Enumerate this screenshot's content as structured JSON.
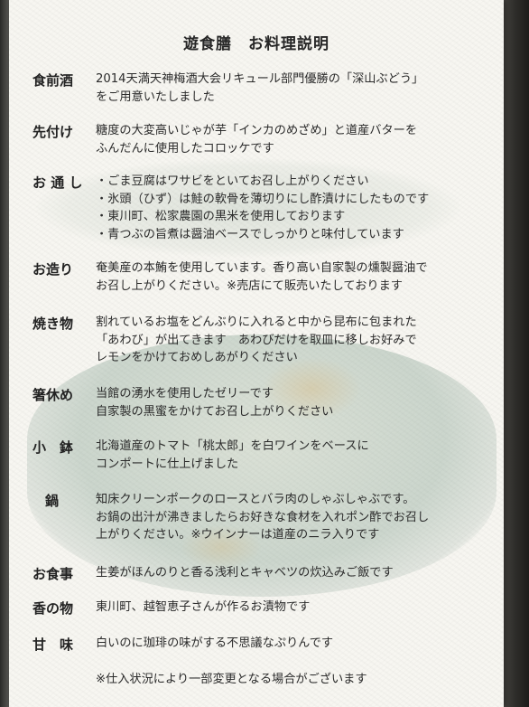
{
  "menu": {
    "title": "遊食膳　お料理説明",
    "sections": [
      {
        "label": "食前酒",
        "lines": [
          "2014天満天神梅酒大会リキュール部門優勝の「深山ぶどう」",
          "をご用意いたしました"
        ]
      },
      {
        "label": "先付け",
        "lines": [
          "糖度の大変高いじゃが芋「インカのめざめ」と道産バターを",
          "ふんだんに使用したコロッケです"
        ]
      },
      {
        "label": "お 通 し",
        "lines": [
          "・ごま豆腐はワサビをといてお召し上がりください",
          "・氷頭（ひず）は鮭の軟骨を薄切りにし酢漬けにしたものです",
          "・東川町、松家農園の黒米を使用しております",
          "・青つぶの旨煮は醤油ベースでしっかりと味付しています"
        ]
      },
      {
        "label": "お造り",
        "lines": [
          "奄美産の本鮪を使用しています。香り高い自家製の燻製醤油で",
          "お召し上がりください。※売店にて販売いたしております"
        ]
      },
      {
        "label": "焼き物",
        "lines": [
          "割れているお塩をどんぶりに入れると中から昆布に包まれた",
          "「あわび」が出てきます　あわびだけを取皿に移しお好みで",
          "レモンをかけておめしあがりください"
        ]
      },
      {
        "label": "箸休め",
        "lines": [
          "当館の湧水を使用したゼリーです",
          "自家製の黒蜜をかけてお召し上がりください"
        ]
      },
      {
        "label": "小　鉢",
        "lines": [
          "北海道産のトマト「桃太郎」を白ワインをベースに",
          "コンポートに仕上げました"
        ]
      },
      {
        "label": "鍋",
        "lines": [
          "知床クリーンポークのロースとバラ肉のしゃぶしゃぶです。",
          "お鍋の出汁が沸きましたらお好きな食材を入れポン酢でお召し",
          "上がりください。※ウインナーは道産のニラ入りです"
        ]
      },
      {
        "label": "お食事",
        "lines": [
          "生姜がほんのりと香る浅利とキャベツの炊込みご飯です"
        ]
      },
      {
        "label": "香の物",
        "lines": [
          "東川町、越智恵子さんが作るお漬物です"
        ]
      },
      {
        "label": "甘　味",
        "lines": [
          "白いのに珈琲の味がする不思議なぷりんです"
        ]
      }
    ],
    "footnote": "※仕入状況により一部変更となる場合がございます"
  }
}
